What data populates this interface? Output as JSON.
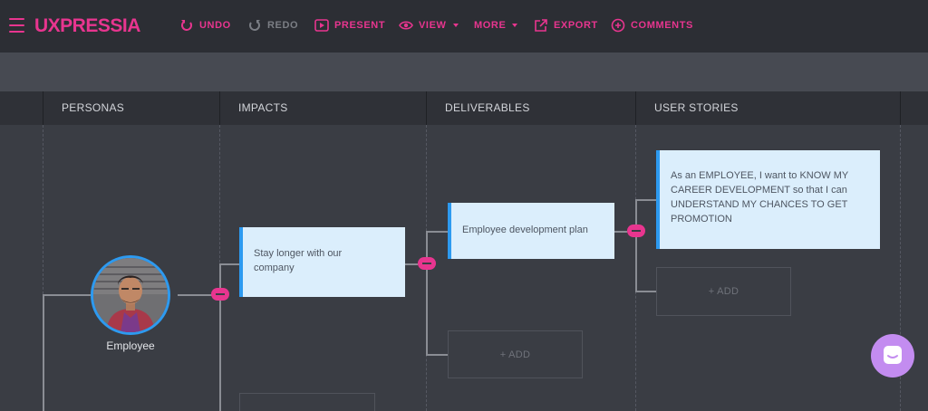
{
  "app": {
    "logo": "UXPRESSIA",
    "accent": "#e8358f"
  },
  "toolbar": {
    "undo": "UNDO",
    "redo": "REDO",
    "present": "PRESENT",
    "view": "VIEW",
    "more": "MORE",
    "export": "EXPORT",
    "comments": "COMMENTS"
  },
  "columns": [
    "PERSONAS",
    "IMPACTS",
    "DELIVERABLES",
    "USER STORIES"
  ],
  "persona": {
    "name": "Employee"
  },
  "impacts": [
    {
      "lines": [
        "Stay longer with our",
        "company"
      ]
    }
  ],
  "deliverables": [
    {
      "lines": [
        "Employee development plan"
      ]
    }
  ],
  "user_stories": [
    {
      "lines": [
        "As an EMPLOYEE, I want to KNOW MY",
        "CAREER DEVELOPMENT so that I can",
        "UNDERSTAND MY CHANCES TO GET",
        "PROMOTION"
      ]
    }
  ],
  "add_label": "+ ADD",
  "colors": {
    "card_bg": "#dbeefc",
    "card_border": "#2d9af0",
    "chat_button": "#c38cf0"
  }
}
